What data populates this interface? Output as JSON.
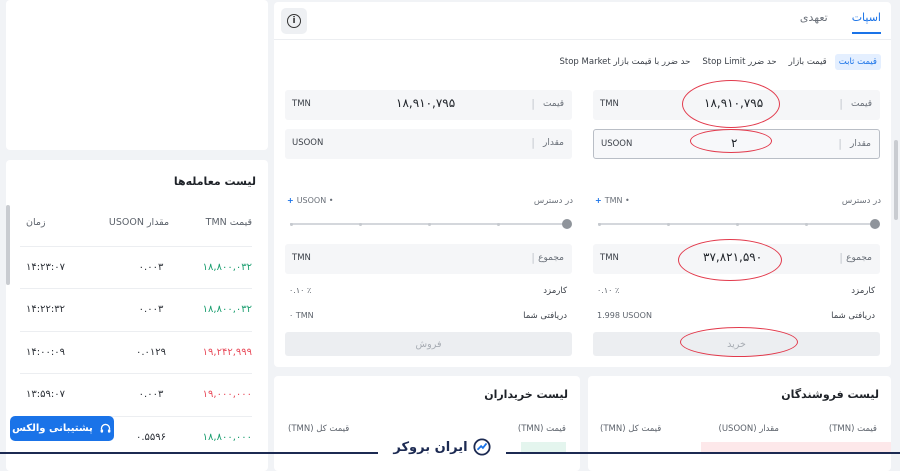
{
  "trades": {
    "title": "لیست معامله‌ها",
    "headers": {
      "price": "قیمت TMN",
      "amount": "مقدار USOON",
      "time": "زمان"
    },
    "rows": [
      {
        "price": "۱۸,۸۰۰,۰۳۲",
        "amount": "۰.۰۰۳",
        "time": "۱۴:۲۳:۰۷",
        "side": "buy"
      },
      {
        "price": "۱۸,۸۰۰,۰۳۲",
        "amount": "۰.۰۰۳",
        "time": "۱۴:۲۲:۳۲",
        "side": "buy"
      },
      {
        "price": "۱۹,۲۴۲,۹۹۹",
        "amount": "۰.۰۱۲۹",
        "time": "۱۴:۰۰:۰۹",
        "side": "sell"
      },
      {
        "price": "۱۹,۰۰۰,۰۰۰",
        "amount": "۰.۰۰۳",
        "time": "۱۳:۵۹:۰۷",
        "side": "sell"
      },
      {
        "price": "۱۸,۸۰۰,۰۰۰",
        "amount": "۰.۵۵۹۶",
        "time": "",
        "side": "buy"
      }
    ]
  },
  "support": {
    "label": "پشتیبانی والکس"
  },
  "tabs": {
    "spot": "اسپات",
    "margin": "تعهدی"
  },
  "order_types": [
    "قیمت ثابت",
    "قیمت بازار",
    "حد ضرر Stop Limit",
    "حد ضرر با قیمت بازار Stop Market"
  ],
  "buy": {
    "price_label": "قیمت",
    "price_value": "۱۸,۹۱۰,۷۹۵",
    "price_unit": "TMN",
    "amount_label": "مقدار",
    "amount_value": "۲",
    "amount_unit": "USOON",
    "available_label": "در دسترس",
    "available_asset": "TMN",
    "total_label": "مجموع",
    "total_value": "۳۷,۸۲۱,۵۹۰",
    "total_unit": "TMN",
    "fee_label": "کارمزد",
    "fee_value": "۰.۱۰ ٪",
    "receive_label": "دریافتی شما",
    "receive_value": "1.998 USOON",
    "button": "خرید"
  },
  "sell": {
    "price_label": "قیمت",
    "price_value": "۱۸,۹۱۰,۷۹۵",
    "price_unit": "TMN",
    "amount_label": "مقدار",
    "amount_unit": "USOON",
    "available_label": "در دسترس",
    "available_asset": "USOON",
    "total_label": "مجموع",
    "total_unit": "TMN",
    "fee_label": "کارمزد",
    "fee_value": "۰.۱۰ ٪",
    "receive_label": "دریافتی شما",
    "receive_value": "۰ TMN",
    "button": "فروش"
  },
  "sellers_book": {
    "title": "لیست فروشندگان",
    "headers": {
      "price": "قیمت (TMN)",
      "amount": "مقدار (USOON)",
      "total": "قیمت کل (TMN)"
    }
  },
  "buyers_book": {
    "title": "لیست خریداران",
    "headers": {
      "price": "قیمت (TMN)",
      "total": "قیمت کل (TMN)"
    }
  },
  "logo": {
    "text": "ایران بروکر"
  },
  "colors": {
    "accent": "#1a73e8",
    "buy": "#1a9e6f",
    "sell": "#e84c5b",
    "highlight": "#e23a4c"
  }
}
